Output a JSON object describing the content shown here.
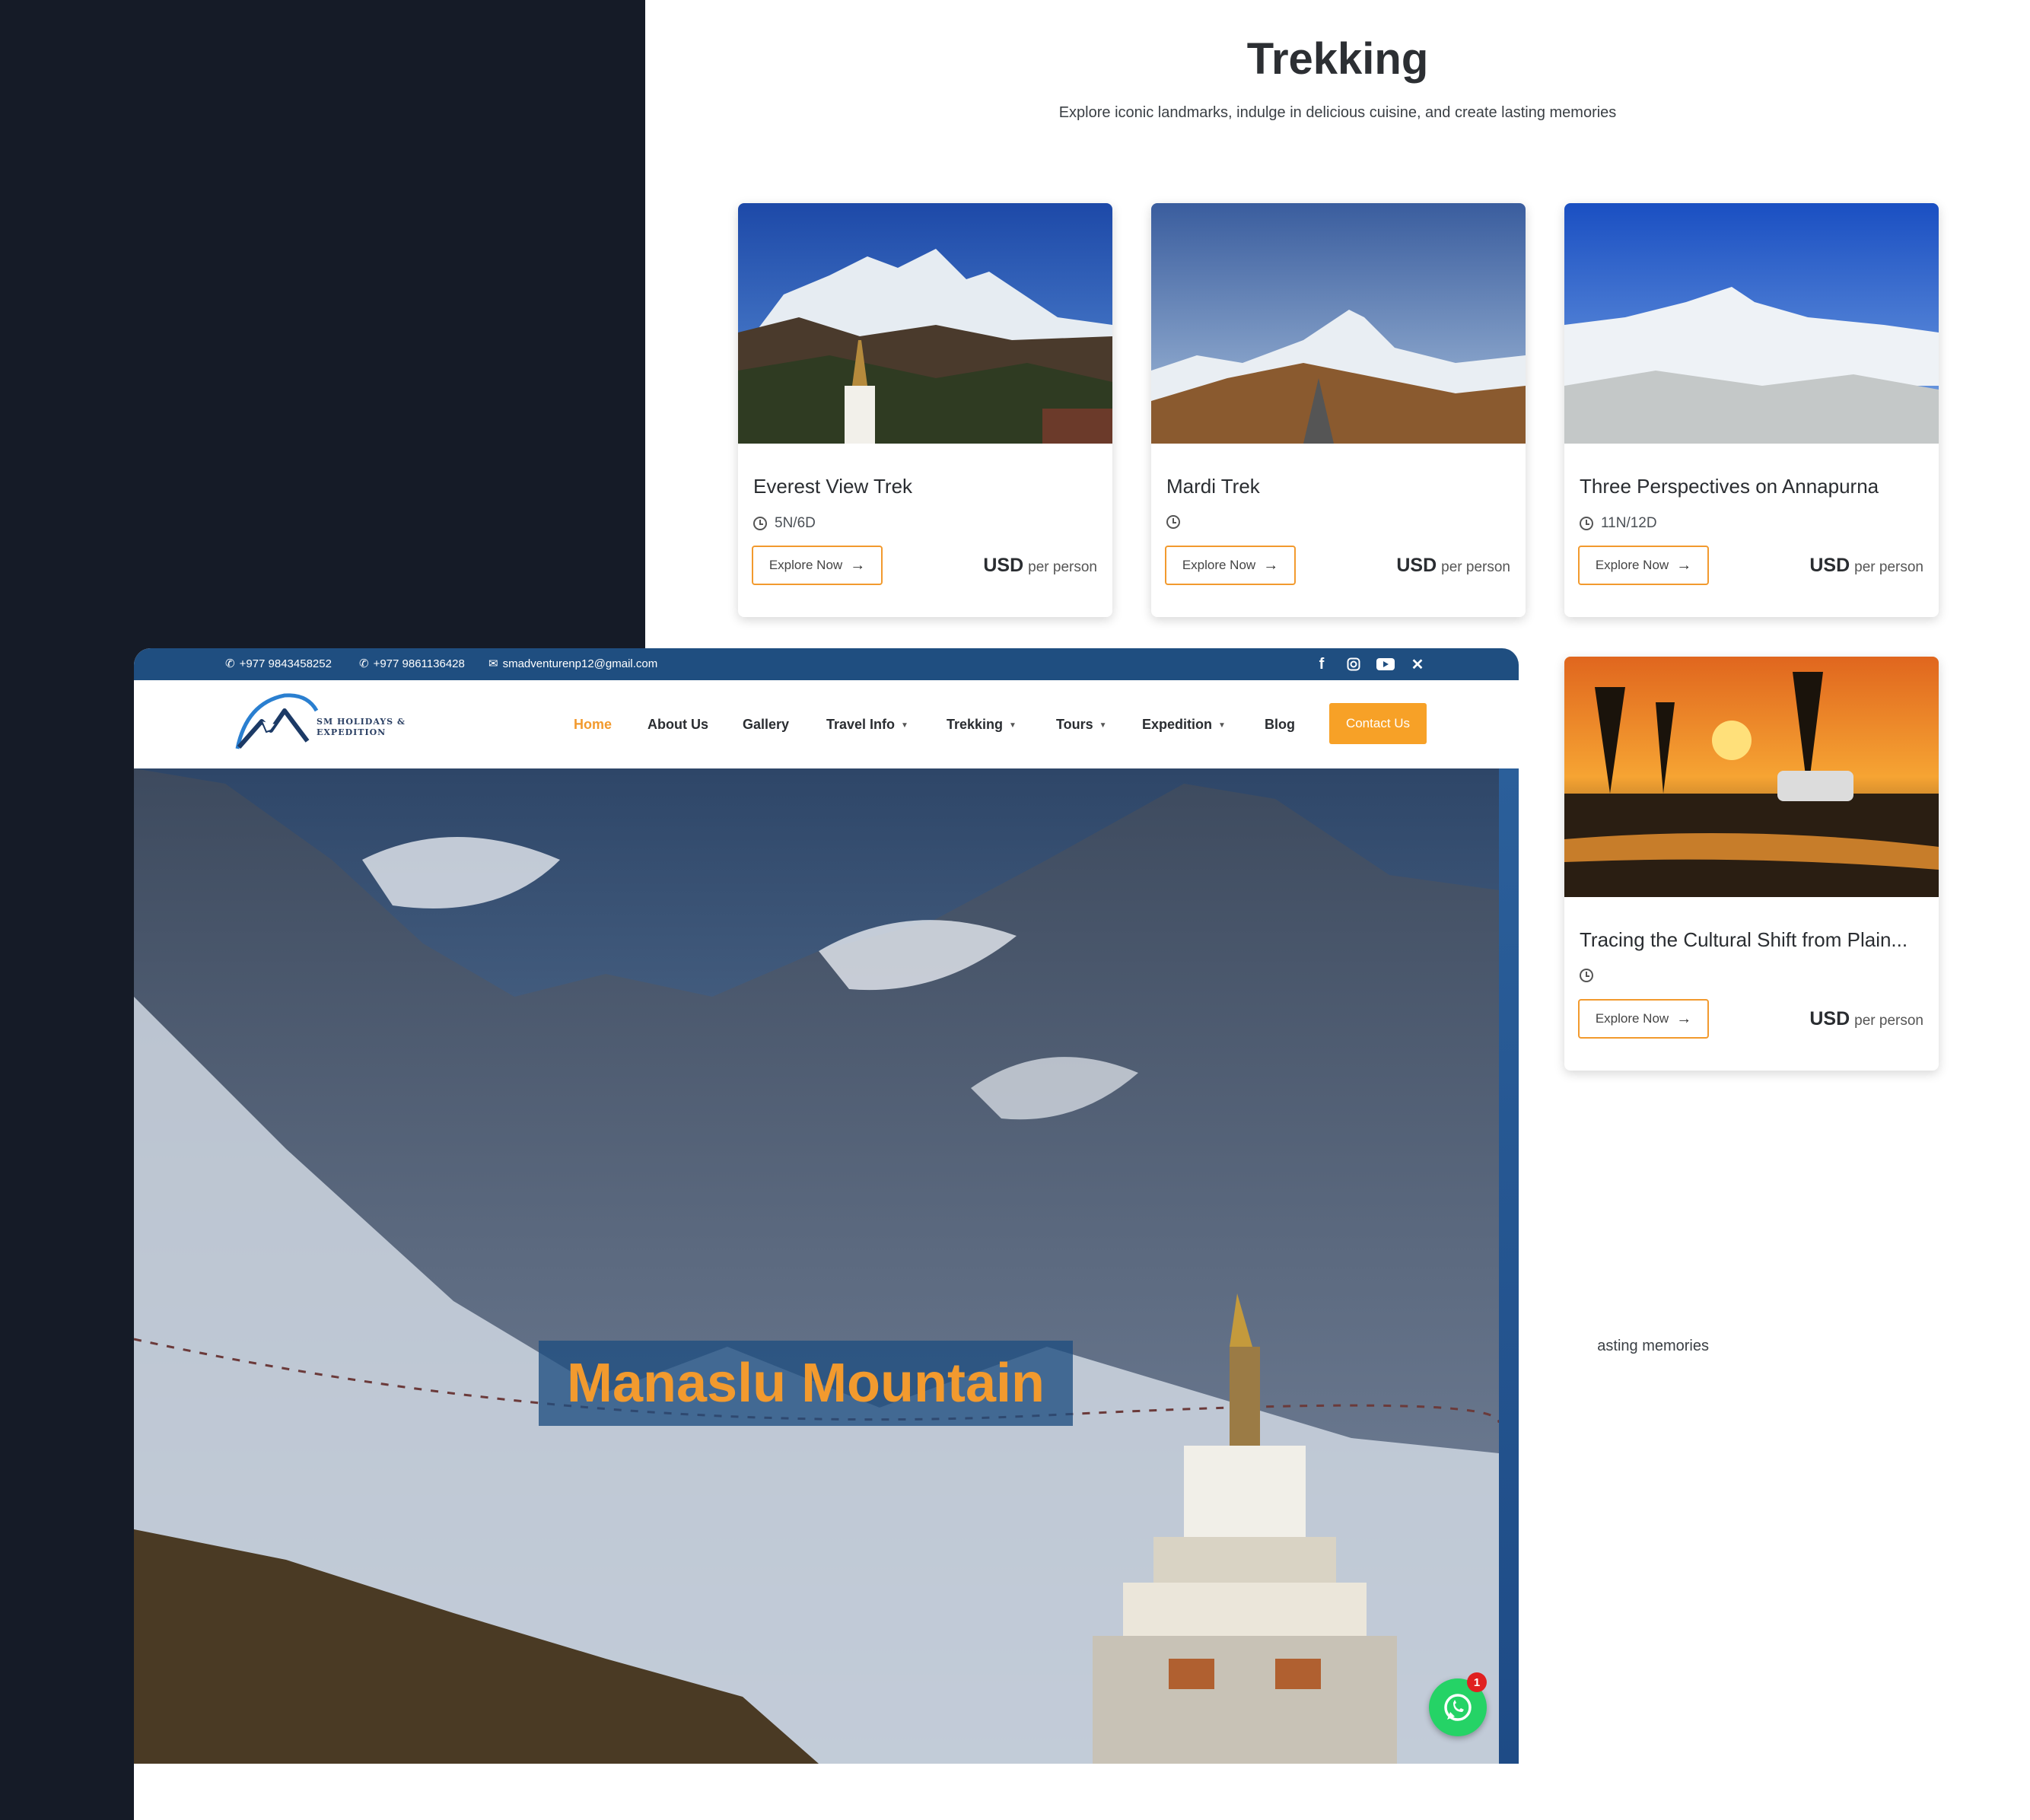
{
  "section": {
    "title": "Trekking",
    "subtitle": "Explore iconic landmarks, indulge in delicious cuisine, and create lasting memories",
    "subtitle_fragment": "asting memories"
  },
  "cards": [
    {
      "title": "Everest View Trek",
      "duration": "5N/6D",
      "button": "Explore Now",
      "currency": "USD",
      "price_suffix": "per person"
    },
    {
      "title": "Mardi Trek",
      "duration": "",
      "button": "Explore Now",
      "currency": "USD",
      "price_suffix": "per person"
    },
    {
      "title": "Three Perspectives on Annapurna",
      "duration": "11N/12D",
      "button": "Explore Now",
      "currency": "USD",
      "price_suffix": "per person"
    },
    {
      "title": "Tracing the Cultural Shift from Plain...",
      "duration": "",
      "button": "Explore Now",
      "currency": "USD",
      "price_suffix": "per person"
    }
  ],
  "site": {
    "topbar": {
      "phone1": "+977 9843458252",
      "phone2": "+977 9861136428",
      "email": "smadventurenp12@gmail.com",
      "social_icons": [
        "facebook-icon",
        "instagram-icon",
        "youtube-icon",
        "x-icon"
      ]
    },
    "logo_line1": "SM HOLIDAYS &",
    "logo_line2": "EXPEDITION",
    "nav": {
      "home": "Home",
      "about": "About Us",
      "gallery": "Gallery",
      "travel_info": "Travel Info",
      "trekking": "Trekking",
      "tours": "Tours",
      "expedition": "Expedition",
      "blog": "Blog",
      "contact": "Contact Us"
    },
    "hero_title": "Manaslu Mountain",
    "whatsapp_badge": "1"
  },
  "colors": {
    "accent": "#f29a2e",
    "topbar": "#1f4e80",
    "dark_bg": "#151b27",
    "whatsapp": "#25d366"
  }
}
